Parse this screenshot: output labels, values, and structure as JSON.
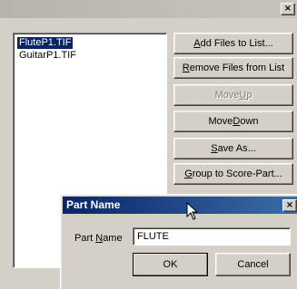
{
  "main_dialog": {
    "close_label": "×"
  },
  "file_list": {
    "items": [
      {
        "label": "FluteP1.TIF",
        "selected": true
      },
      {
        "label": "GuitarP1.TIF",
        "selected": false
      }
    ]
  },
  "buttons": {
    "add_files": {
      "pre": "",
      "u": "A",
      "post": "dd Files to List..."
    },
    "remove_files": {
      "pre": "",
      "u": "R",
      "post": "emove Files from List"
    },
    "move_up": {
      "pre": "Move ",
      "u": "U",
      "post": "p"
    },
    "move_down": {
      "pre": "Move ",
      "u": "D",
      "post": "own"
    },
    "save_as": {
      "pre": "",
      "u": "S",
      "post": "ave As..."
    },
    "group": {
      "pre": "",
      "u": "G",
      "post": "roup to Score-Part..."
    }
  },
  "part_name_dialog": {
    "title": "Part Name",
    "close_label": "×",
    "label": {
      "pre": "Part ",
      "u": "N",
      "post": "ame"
    },
    "value": "FLUTE",
    "ok_label": "OK",
    "cancel_label": "Cancel"
  },
  "colors": {
    "selection": "#0a246a",
    "titlebar_active": "#0a246a",
    "face": "#d4d0c8"
  }
}
